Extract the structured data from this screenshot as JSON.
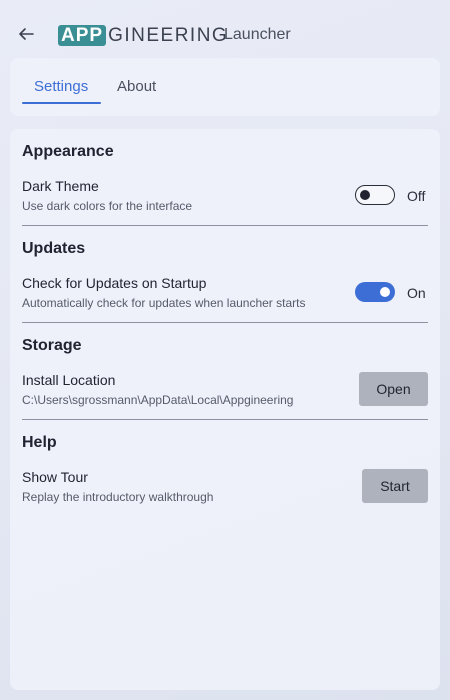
{
  "header": {
    "logo_highlight": "APP",
    "logo_rest": "GINEERING",
    "subtitle": "Launcher",
    "back_icon": "arrow-left-icon"
  },
  "tabs": [
    {
      "label": "Settings",
      "active": true
    },
    {
      "label": "About",
      "active": false
    }
  ],
  "sections": {
    "appearance": {
      "title": "Appearance",
      "dark_theme": {
        "title": "Dark Theme",
        "description": "Use dark colors for the interface",
        "state": "Off",
        "enabled": false
      }
    },
    "updates": {
      "title": "Updates",
      "check_on_startup": {
        "title": "Check for Updates on Startup",
        "description": "Automatically check for updates when launcher starts",
        "state": "On",
        "enabled": true
      }
    },
    "storage": {
      "title": "Storage",
      "install_location": {
        "title": "Install Location",
        "description": "C:\\Users\\sgrossmann\\AppData\\Local\\Appgineering",
        "button_label": "Open"
      }
    },
    "help": {
      "title": "Help",
      "show_tour": {
        "title": "Show Tour",
        "description": "Replay the introductory walkthrough",
        "button_label": "Start"
      }
    }
  },
  "colors": {
    "accent": "#3d6ed6",
    "logo_teal": "#3a8f94",
    "button_gray": "#aeb2bd"
  }
}
